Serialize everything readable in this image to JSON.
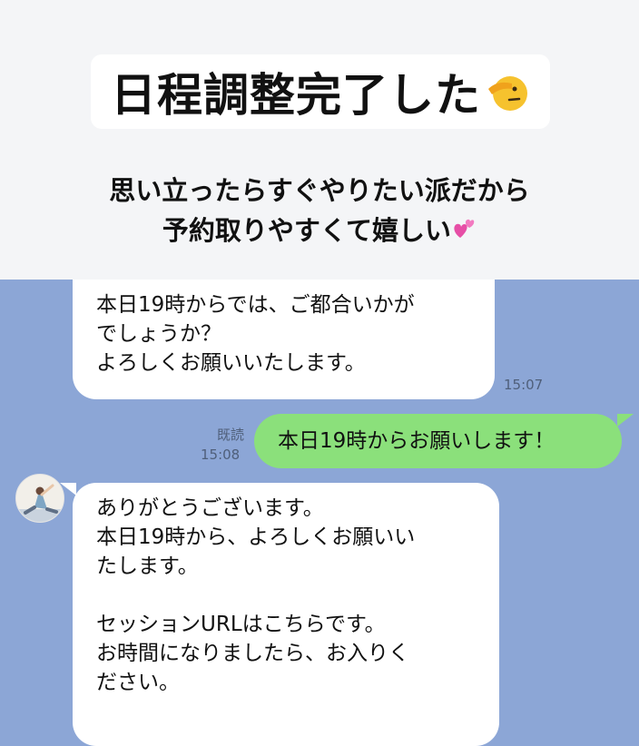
{
  "header": {
    "title": "日程調整完了した",
    "title_emoji": "saluting-face-icon",
    "subtitle_line1": "思い立ったらすぐやりたい派だから",
    "subtitle_line2": "予約取りやすくて嬉しい",
    "subtitle_emoji": "two-hearts-icon"
  },
  "messages": [
    {
      "side": "incoming",
      "lines": [
        "本日19時からでは、ご都合いかが",
        "でしょうか？",
        "よろしくお願いいたします。"
      ],
      "time": "15:07"
    },
    {
      "side": "outgoing",
      "text": "本日19時からお願いします！",
      "read": "既読",
      "time": "15:08"
    },
    {
      "side": "incoming",
      "lines": [
        "ありがとうございます。",
        "本日19時から、よろしくお願いい",
        "たします。",
        "",
        "セッションURLはこちらです。",
        "お時間になりましたら、お入りく",
        "ださい。"
      ]
    }
  ],
  "colors": {
    "header_bg": "#f4f5f7",
    "chat_bg": "#8ca6d6",
    "outgoing_bubble": "#8be07b",
    "incoming_bubble": "#ffffff"
  }
}
